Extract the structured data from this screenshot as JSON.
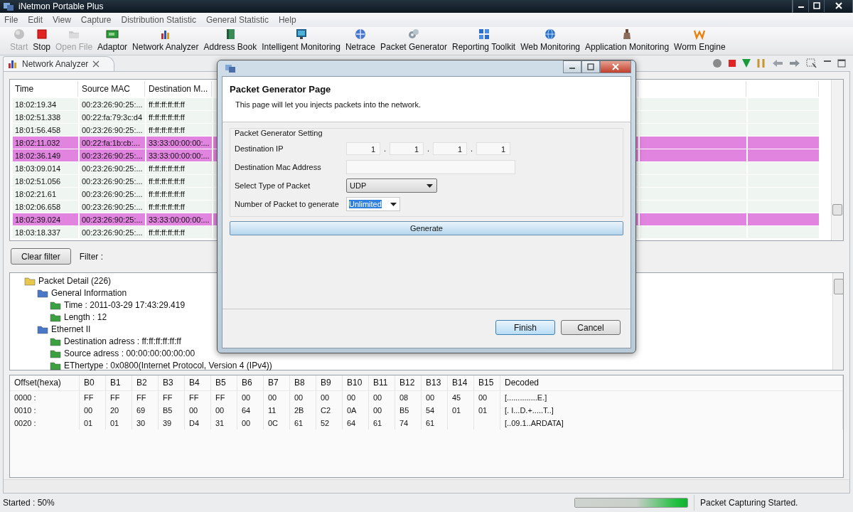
{
  "window": {
    "title": "iNetmon Portable Plus"
  },
  "menu": [
    "File",
    "Edit",
    "View",
    "Capture",
    "Distribution Statistic",
    "General Statistic",
    "Help"
  ],
  "toolbar": [
    {
      "label": "Start",
      "disabled": true
    },
    {
      "label": "Stop",
      "disabled": false
    },
    {
      "label": "Open File",
      "disabled": true
    },
    {
      "label": "Adaptor",
      "disabled": false
    },
    {
      "label": "Network Analyzer",
      "disabled": false
    },
    {
      "label": "Address Book",
      "disabled": false
    },
    {
      "label": "Intelligent Monitoring",
      "disabled": false
    },
    {
      "label": "Netrace",
      "disabled": false
    },
    {
      "label": "Packet Generator",
      "disabled": false
    },
    {
      "label": "Reporting Toolkit",
      "disabled": false
    },
    {
      "label": "Web Monitoring",
      "disabled": false
    },
    {
      "label": "Application Monitoring",
      "disabled": false
    },
    {
      "label": "Worm Engine",
      "disabled": false
    }
  ],
  "tabs": [
    {
      "label": "Network Analyzer",
      "selected": true
    }
  ],
  "packets": {
    "columns": [
      "Time",
      "Source MAC",
      "Destination M..."
    ],
    "rows": [
      {
        "cells": [
          "18:02:19.34",
          "00:23:26:90:25:...",
          "ff:ff:ff:ff:ff:ff"
        ],
        "highlighted": false
      },
      {
        "cells": [
          "18:02:51.338",
          "00:22:fa:79:3c:d4",
          "ff:ff:ff:ff:ff:ff"
        ],
        "highlighted": false
      },
      {
        "cells": [
          "18:01:56.458",
          "00:23:26:90:25:...",
          "ff:ff:ff:ff:ff:ff"
        ],
        "highlighted": false
      },
      {
        "cells": [
          "18:02:11.032",
          "00:22:fa:1b:cb:...",
          "33:33:00:00:00:..."
        ],
        "highlighted": true
      },
      {
        "cells": [
          "18:02:36.149",
          "00:23:26:90:25:...",
          "33:33:00:00:00:..."
        ],
        "highlighted": true
      },
      {
        "cells": [
          "18:03:09.014",
          "00:23:26:90:25:...",
          "ff:ff:ff:ff:ff:ff"
        ],
        "highlighted": false
      },
      {
        "cells": [
          "18:02:51.056",
          "00:23:26:90:25:...",
          "ff:ff:ff:ff:ff:ff"
        ],
        "highlighted": false
      },
      {
        "cells": [
          "18:02:21.61",
          "00:23:26:90:25:...",
          "ff:ff:ff:ff:ff:ff"
        ],
        "highlighted": false
      },
      {
        "cells": [
          "18:02:06.658",
          "00:23:26:90:25:...",
          "ff:ff:ff:ff:ff:ff"
        ],
        "highlighted": false
      },
      {
        "cells": [
          "18:02:39.024",
          "00:23:26:90:25:...",
          "33:33:00:00:00:..."
        ],
        "highlighted": true
      },
      {
        "cells": [
          "18:03:18.337",
          "00:23:26:90:25:...",
          "ff:ff:ff:ff:ff:ff"
        ],
        "highlighted": false
      }
    ]
  },
  "filter": {
    "button": "Clear filter",
    "label": "Filter :"
  },
  "packet_detail": [
    {
      "label": "Packet Detail (226)",
      "children": [
        {
          "label": "General Information",
          "children": [
            {
              "label": "Time : 2011-03-29 17:43:29.419"
            },
            {
              "label": "Length : 12"
            }
          ]
        },
        {
          "label": "Ethernet II",
          "children": [
            {
              "label": "Destination adress : ff:ff:ff:ff:ff:ff"
            },
            {
              "label": "Source adress : 00:00:00:00:00:00"
            },
            {
              "label": "EThertype : 0x0800(Internet Protocol, Version 4 (IPv4))"
            }
          ]
        }
      ]
    }
  ],
  "hex": {
    "columns": [
      "Offset(hexa)",
      "B0",
      "B1",
      "B2",
      "B3",
      "B4",
      "B5",
      "B6",
      "B7",
      "B8",
      "B9",
      "B10",
      "B11",
      "B12",
      "B13",
      "B14",
      "B15",
      "Decoded"
    ],
    "rows": [
      [
        "0000  :",
        "FF",
        "FF",
        "FF",
        "FF",
        "FF",
        "FF",
        "00",
        "00",
        "00",
        "00",
        "00",
        "00",
        "08",
        "00",
        "45",
        "00",
        "[..............E.]"
      ],
      [
        "0010  :",
        "00",
        "20",
        "69",
        "B5",
        "00",
        "00",
        "64",
        "11",
        "2B",
        "C2",
        "0A",
        "00",
        "B5",
        "54",
        "01",
        "01",
        "[. I...D.+.....T..]"
      ],
      [
        "0020  :",
        "01",
        "01",
        "30",
        "39",
        "D4",
        "31",
        "00",
        "0C",
        "61",
        "52",
        "64",
        "61",
        "74",
        "61",
        null,
        null,
        "[..09.1..ARDATA]"
      ]
    ]
  },
  "status_bar": {
    "progress": "Started :  50%",
    "level": 1,
    "message": "Packet Capturing Started."
  },
  "dialog": {
    "heading": "Packet Generator Page",
    "description": "This page will let you injects packets into the network.",
    "group": "Packet Generator Setting",
    "fields": [
      {
        "kind": "ip",
        "label": "Destination IP",
        "octets": [
          "1",
          "1",
          "1",
          "1"
        ],
        "separator": "."
      },
      {
        "kind": "text",
        "label": "Destination Mac Address"
      },
      {
        "kind": "select",
        "label": "Select Type of Packet",
        "value": "UDP"
      },
      {
        "kind": "combo",
        "label": "Number of Packet to generate",
        "value": "Unlimited",
        "highlighted": true
      }
    ],
    "generate": "Generate",
    "buttons": [
      {
        "label": "Finish",
        "default": true
      },
      {
        "label": "Cancel",
        "default": false
      }
    ]
  }
}
